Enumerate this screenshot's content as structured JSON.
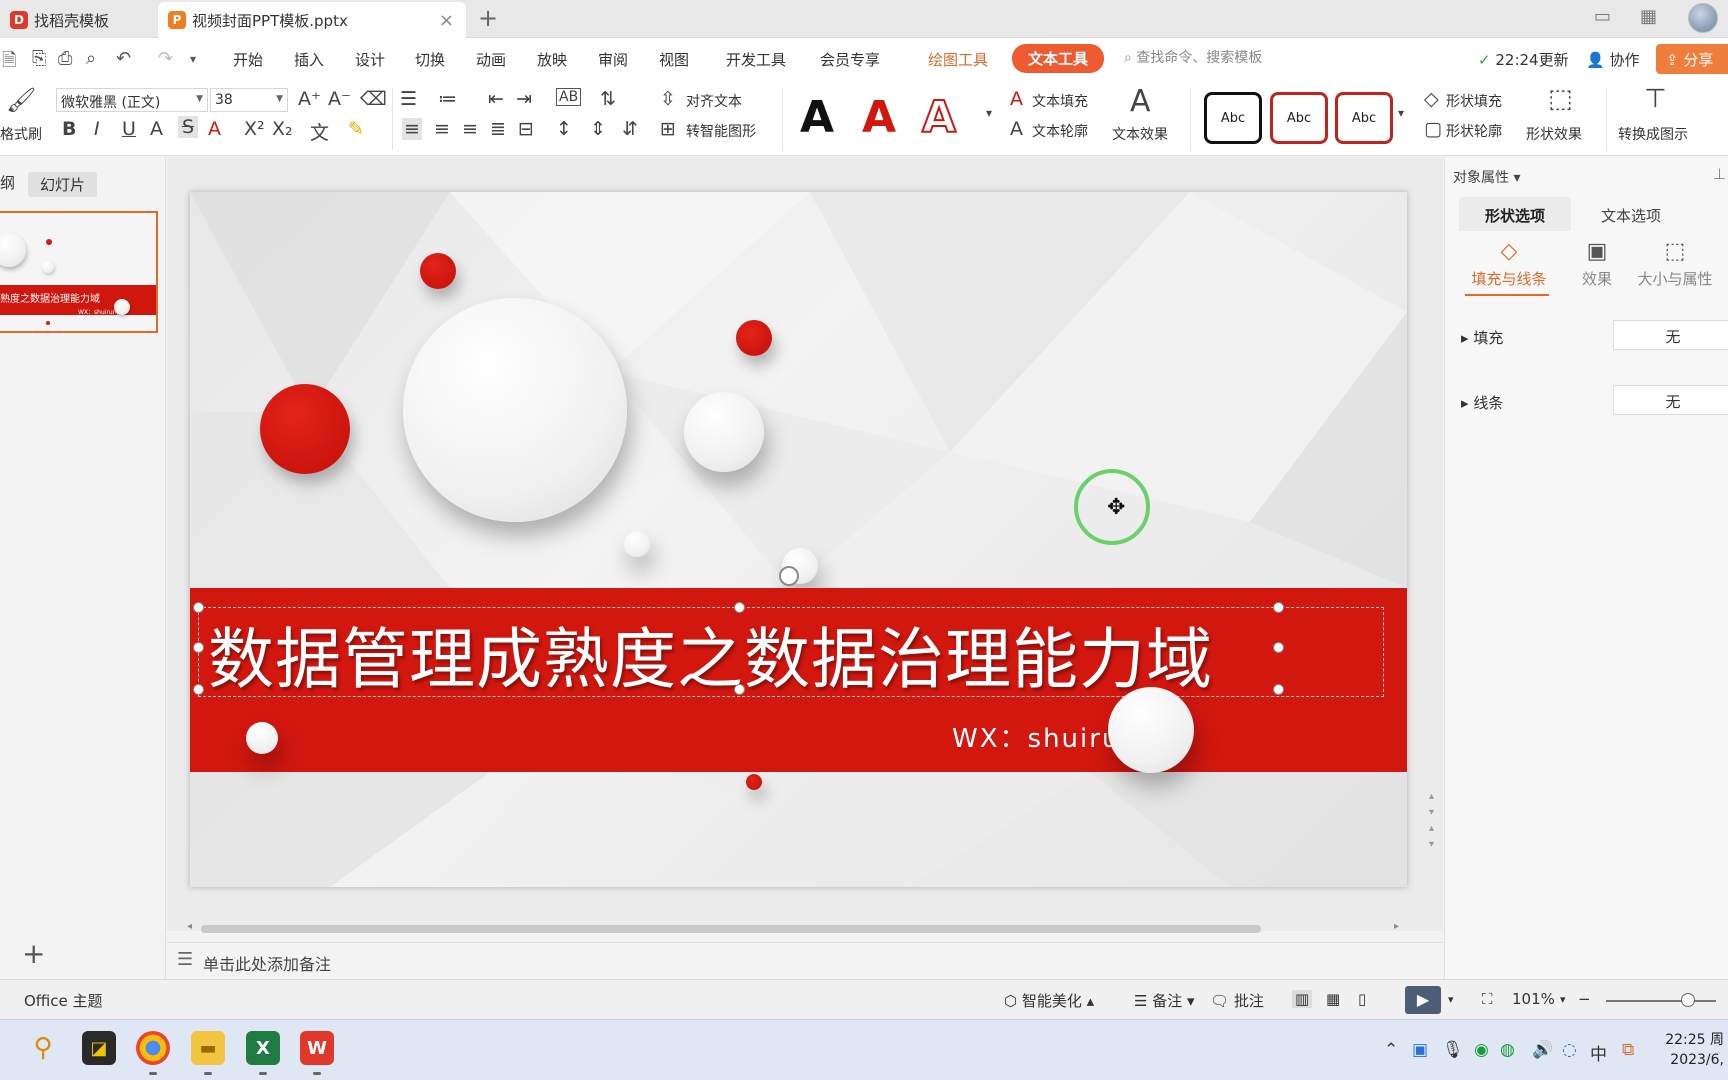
{
  "tabs": {
    "inactive_title": "找稻壳模板",
    "active_title": "视频封面PPT模板.pptx",
    "close_icon": "×",
    "add_icon": "+"
  },
  "menu": {
    "items": [
      "开始",
      "插入",
      "设计",
      "切换",
      "动画",
      "放映",
      "审阅",
      "视图",
      "开发工具",
      "会员专享"
    ],
    "context_draw": "绘图工具",
    "context_text": "文本工具",
    "search_placeholder": "查找命令、搜索模板",
    "update": "22:24更新",
    "collab": "协作",
    "share": "分享"
  },
  "ribbon": {
    "format_painter": "格式刷",
    "font_name": "微软雅黑 (正文)",
    "font_size": "38",
    "align_text": "对齐文本",
    "to_smart": "转智能图形",
    "text_fill": "文本填充",
    "text_outline": "文本轮廓",
    "text_effect": "文本效果",
    "style_sample": "Abc",
    "shape_fill": "形状填充",
    "shape_outline": "形状轮廓",
    "shape_effect": "形状效果",
    "convert_diagram": "转换成图示",
    "colors": {
      "accent": "#e06a2c",
      "red": "#d2170f"
    }
  },
  "left_pane": {
    "tab_outline": "纲",
    "tab_slides": "幻灯片",
    "thumb_title": "熟度之数据治理能力域",
    "thumb_sub": "WX：shuirunjj",
    "add_icon": "+"
  },
  "slide": {
    "title": "数据管理成熟度之数据治理能力域",
    "subtitle": "WX：shuirunjj"
  },
  "notes": {
    "placeholder": "单击此处添加备注"
  },
  "right_pane": {
    "title": "对象属性",
    "tab_shape": "形状选项",
    "tab_text": "文本选项",
    "sub_fill_line": "填充与线条",
    "sub_effect": "效果",
    "sub_size": "大小与属性",
    "fill_label": "填充",
    "fill_value": "无",
    "line_label": "线条",
    "line_value": "无"
  },
  "status": {
    "theme": "Office 主题",
    "beautify": "智能美化",
    "notes": "备注",
    "comments": "批注",
    "zoom": "101%"
  },
  "taskbar": {
    "time": "22:25 周",
    "date": "2023/6,"
  }
}
